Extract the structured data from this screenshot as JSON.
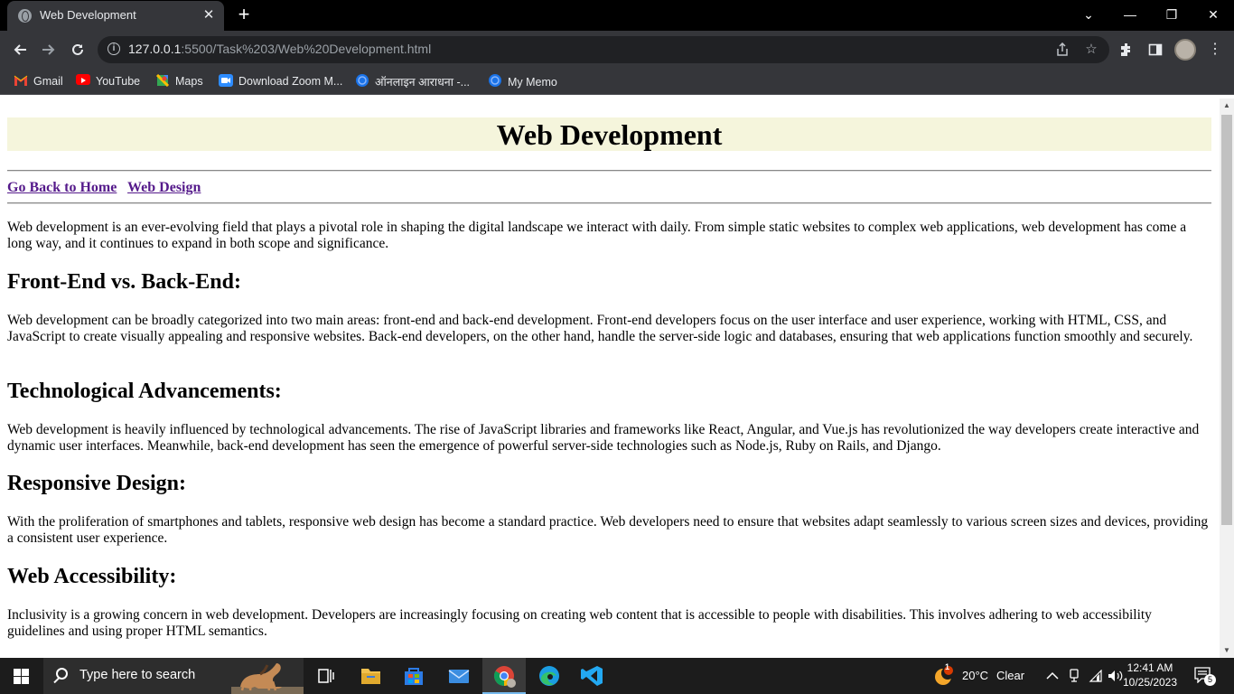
{
  "browser": {
    "tab": {
      "title": "Web Development",
      "close": "✕"
    },
    "new_tab": "+",
    "window_controls": {
      "minimize": "—",
      "restore": "❐",
      "close": "✕",
      "dropdown": "⌄"
    },
    "url": {
      "host": "127.0.0.1",
      "path": ":5500/Task%203/Web%20Development.html"
    },
    "bookmarks": [
      {
        "label": "Gmail",
        "icon": "gmail-icon",
        "color": "#ea4335"
      },
      {
        "label": "YouTube",
        "icon": "youtube-icon",
        "color": "#ff0000"
      },
      {
        "label": "Maps",
        "icon": "maps-icon",
        "color": "#34a853"
      },
      {
        "label": "Download Zoom M...",
        "icon": "zoom-icon",
        "color": "#2d8cff"
      },
      {
        "label": "ऑनलाइन आराधना -...",
        "icon": "globe-icon",
        "color": "#1a73e8"
      },
      {
        "label": "My Memo",
        "icon": "globe-icon",
        "color": "#1a73e8"
      }
    ]
  },
  "page": {
    "title": "Web Development",
    "header_bg": "#f5f5dc",
    "links": [
      "Go Back to Home",
      "Web Design"
    ],
    "intro": "Web development is an ever-evolving field that plays a pivotal role in shaping the digital landscape we interact with daily. From simple static websites to complex web applications, web development has come a long way, and it continues to expand in both scope and significance.",
    "sections": [
      {
        "heading": "Front-End vs. Back-End:",
        "text": "Web development can be broadly categorized into two main areas: front-end and back-end development. Front-end developers focus on the user interface and user experience, working with HTML, CSS, and JavaScript to create visually appealing and responsive websites. Back-end developers, on the other hand, handle the server-side logic and databases, ensuring that web applications function smoothly and securely."
      },
      {
        "heading": "Technological Advancements:",
        "text": "Web development is heavily influenced by technological advancements. The rise of JavaScript libraries and frameworks like React, Angular, and Vue.js has revolutionized the way developers create interactive and dynamic user interfaces. Meanwhile, back-end development has seen the emergence of powerful server-side technologies such as Node.js, Ruby on Rails, and Django."
      },
      {
        "heading": "Responsive Design:",
        "text": "With the proliferation of smartphones and tablets, responsive web design has become a standard practice. Web developers need to ensure that websites adapt seamlessly to various screen sizes and devices, providing a consistent user experience."
      },
      {
        "heading": "Web Accessibility:",
        "text": "Inclusivity is a growing concern in web development. Developers are increasingly focusing on creating web content that is accessible to people with disabilities. This involves adhering to web accessibility guidelines and using proper HTML semantics."
      }
    ]
  },
  "taskbar": {
    "search_placeholder": "Type here to search",
    "weather": {
      "temp": "20°C",
      "condition": "Clear",
      "badge": "1"
    },
    "time": "12:41 AM",
    "date": "10/25/2023",
    "notification_count": "5"
  }
}
